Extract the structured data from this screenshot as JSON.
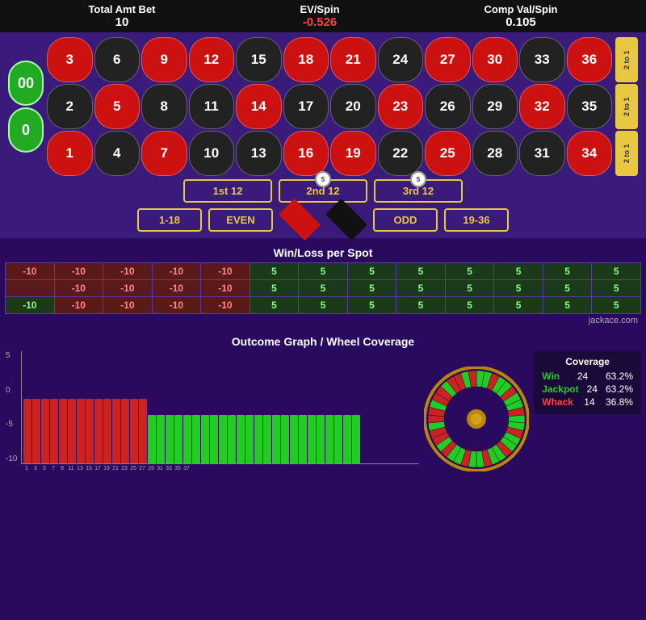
{
  "header": {
    "total_amt_bet_label": "Total Amt Bet",
    "total_amt_bet_value": "10",
    "ev_spin_label": "EV/Spin",
    "ev_spin_value": "-0.526",
    "comp_val_label": "Comp Val/Spin",
    "comp_val_value": "0.105"
  },
  "roulette": {
    "zeros": [
      "00",
      "0"
    ],
    "numbers": [
      [
        3,
        6,
        9,
        12,
        15,
        18,
        21,
        24,
        27,
        30,
        33,
        36
      ],
      [
        2,
        5,
        8,
        11,
        14,
        17,
        20,
        23,
        26,
        29,
        32,
        35
      ],
      [
        1,
        4,
        7,
        10,
        13,
        16,
        19,
        22,
        25,
        28,
        31,
        34
      ]
    ],
    "colors": {
      "3": "red",
      "6": "black",
      "9": "red",
      "12": "red",
      "15": "black",
      "18": "red",
      "21": "red",
      "24": "black",
      "27": "red",
      "30": "red",
      "33": "black",
      "36": "red",
      "2": "black",
      "5": "red",
      "8": "black",
      "11": "black",
      "14": "red",
      "17": "black",
      "20": "black",
      "23": "red",
      "26": "black",
      "29": "black",
      "32": "red",
      "35": "black",
      "1": "red",
      "4": "black",
      "7": "red",
      "10": "black",
      "13": "black",
      "16": "red",
      "19": "red",
      "22": "black",
      "25": "red",
      "28": "black",
      "31": "black",
      "34": "red"
    },
    "col_payouts": [
      "2 to 1",
      "2 to 1",
      "2 to 1"
    ],
    "bet_row1": {
      "first12": "1st 12",
      "second12": "2nd 12",
      "third12": "3rd 12",
      "chip5_label": "5"
    },
    "bet_row2": {
      "range1": "1-18",
      "even": "EVEN",
      "odd": "ODD",
      "range2": "19-36"
    }
  },
  "winloss": {
    "title": "Win/Loss per Spot",
    "rows": [
      [
        "-10",
        "-10",
        "-10",
        "-10",
        "-10",
        "5",
        "5",
        "5",
        "5",
        "5",
        "5",
        "5",
        "5"
      ],
      [
        "",
        "-10",
        "-10",
        "-10",
        "-10",
        "5",
        "5",
        "5",
        "5",
        "5",
        "5",
        "5",
        "5"
      ],
      [
        "-10",
        "",
        "-10",
        "-10",
        "-10",
        "-10",
        "5",
        "5",
        "5",
        "5",
        "5",
        "5",
        "5",
        "5"
      ]
    ],
    "jackace": "jackace.com"
  },
  "outcome": {
    "title": "Outcome Graph / Wheel Coverage",
    "y_labels": [
      "5",
      "0",
      "-5",
      "-10"
    ],
    "x_labels": [
      "1",
      "3",
      "5",
      "7",
      "9",
      "11",
      "13",
      "15",
      "17",
      "19",
      "21",
      "23",
      "25",
      "27",
      "29",
      "31",
      "33",
      "35",
      "37"
    ],
    "bars_red_count": 14,
    "bars_green_count": 24,
    "coverage": {
      "title": "Coverage",
      "win_label": "Win",
      "win_count": "24",
      "win_pct": "63.2%",
      "jackpot_label": "Jackpot",
      "jackpot_count": "24",
      "jackpot_pct": "63.2%",
      "whack_label": "Whack",
      "whack_count": "14",
      "whack_pct": "36.8%"
    }
  }
}
